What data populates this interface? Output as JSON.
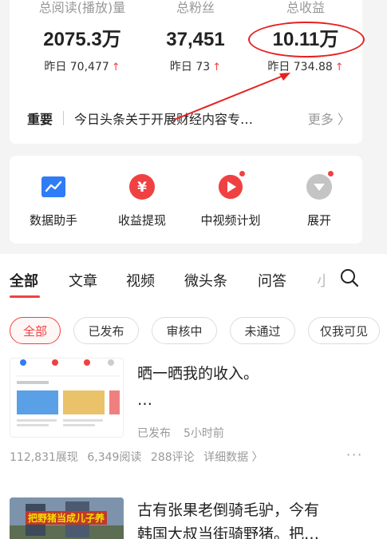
{
  "stats": [
    {
      "label": "总阅读(播放)量",
      "value": "2075.3万",
      "yesterday": "昨日 70,477"
    },
    {
      "label": "总粉丝",
      "value": "37,451",
      "yesterday": "昨日 73"
    },
    {
      "label": "总收益",
      "value": "10.11万",
      "yesterday": "昨日 734.88"
    }
  ],
  "up_arrow": "↑",
  "notice": {
    "tag": "重要",
    "text": "今日头条关于开展财经内容专…",
    "more": "更多 〉"
  },
  "tools": [
    {
      "label": "数据助手",
      "icon": "chart-icon",
      "color": "#2f7cf6"
    },
    {
      "label": "收益提现",
      "icon": "yuan-icon",
      "color": "#f04142"
    },
    {
      "label": "中视频计划",
      "icon": "play-icon",
      "color": "#f04142"
    },
    {
      "label": "展开",
      "icon": "expand-icon",
      "color": "#bbbbbb"
    }
  ],
  "tabs": [
    "全部",
    "文章",
    "视频",
    "微头条",
    "问答",
    "小"
  ],
  "filters": [
    "全部",
    "已发布",
    "审核中",
    "未通过",
    "仅我可见"
  ],
  "posts": [
    {
      "title_line1": "晒一晒我的收入。",
      "title_line2": "…",
      "status": "已发布",
      "time": "5小时前",
      "stats": [
        "112,831展现",
        "6,349阅读",
        "288评论",
        "详细数据 〉"
      ],
      "more": "···"
    },
    {
      "title_line1": "古有张果老倒骑毛驴，今有",
      "title_line2": "韩国大叔当街骑野猪。把…",
      "thumb_caption": "把野猪当成儿子养"
    }
  ],
  "colors": {
    "accent": "#f04142",
    "annotation": "#e82020"
  }
}
